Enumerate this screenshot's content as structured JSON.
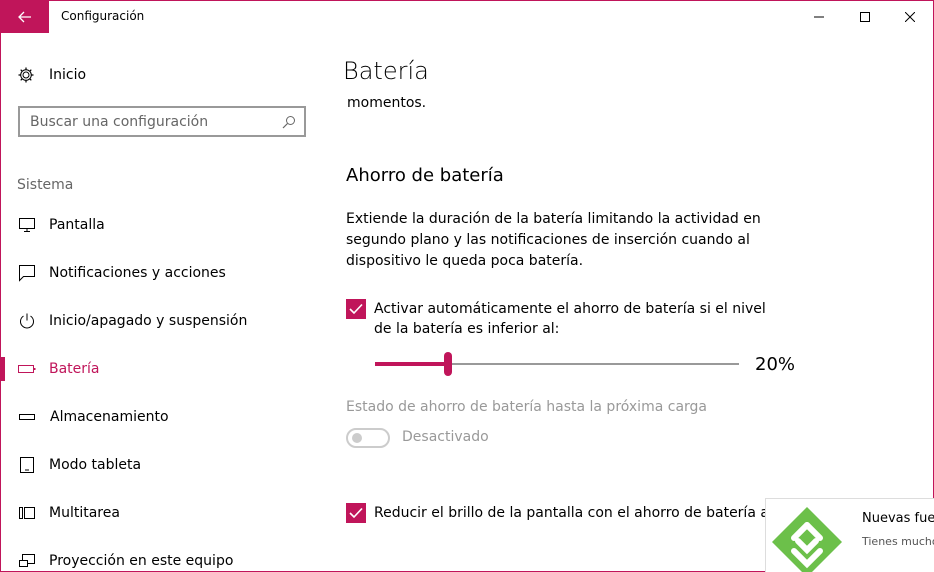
{
  "window": {
    "title": "Configuración"
  },
  "sidebar": {
    "home_label": "Inicio",
    "search_placeholder": "Buscar una configuración",
    "section_label": "Sistema",
    "items": [
      {
        "label": "Pantalla",
        "icon": "monitor-icon"
      },
      {
        "label": "Notificaciones y acciones",
        "icon": "notification-icon"
      },
      {
        "label": "Inicio/apagado y suspensión",
        "icon": "power-icon"
      },
      {
        "label": "Batería",
        "icon": "battery-icon",
        "active": true
      },
      {
        "label": "Almacenamiento",
        "icon": "storage-icon"
      },
      {
        "label": "Modo tableta",
        "icon": "tablet-icon"
      },
      {
        "label": "Multitarea",
        "icon": "multitask-icon"
      },
      {
        "label": "Proyección en este equipo",
        "icon": "projection-icon"
      }
    ]
  },
  "main": {
    "title": "Batería",
    "fragment": "momentos.",
    "saver_title": "Ahorro de batería",
    "saver_desc": "Extiende la duración de la batería limitando la actividad en segundo plano y las notificaciones de inserción cuando al dispositivo le queda poca batería.",
    "auto_checkbox_label": "Activar automáticamente el ahorro de batería si el nivel de la batería es inferior al:",
    "slider_value_text": "20%",
    "slider_fraction": 0.2,
    "state_label": "Estado de ahorro de batería hasta la próxima carga",
    "toggle_label": "Desactivado",
    "reduce_checkbox_label": "Reducir el brillo de la pantalla con el ahorro de batería activ"
  },
  "toast": {
    "title": "Nuevas fuer",
    "body": "Tienes mucho"
  },
  "colors": {
    "accent": "#c0155a",
    "toast_logo": "#6cc04a"
  }
}
